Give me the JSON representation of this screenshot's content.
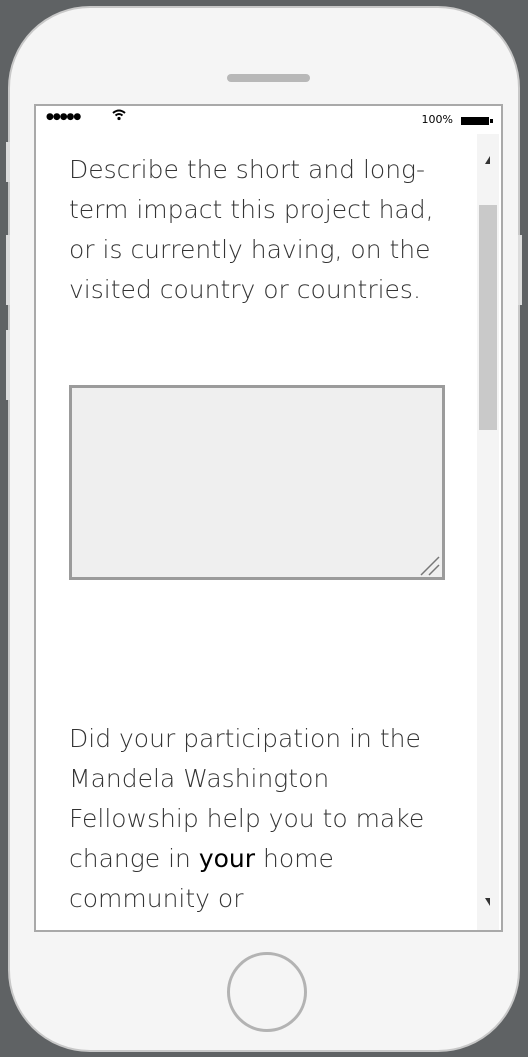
{
  "status_bar": {
    "signal": "●●●●●",
    "battery_text": "100%"
  },
  "form": {
    "question_1": "Describe the short and long-term impact this project had, or is currently having, on the visited country or countries.",
    "answer_1": "",
    "question_2_before": "Did your participation in the Mandela Washington Fellowship help you to make change in ",
    "question_2_bold": "your",
    "question_2_after": " home community or"
  },
  "icons": {
    "wifi": "wifi-icon",
    "battery": "battery-icon",
    "resize": "resize-grip-icon",
    "scroll_up": "scroll-up-arrow-icon",
    "scroll_down": "scroll-down-arrow-icon",
    "home": "home-button"
  },
  "colors": {
    "phone_frame": "#f5f5f5",
    "textarea_fill": "#efefef",
    "textarea_border": "#9b9b9b",
    "text": "#333333"
  }
}
